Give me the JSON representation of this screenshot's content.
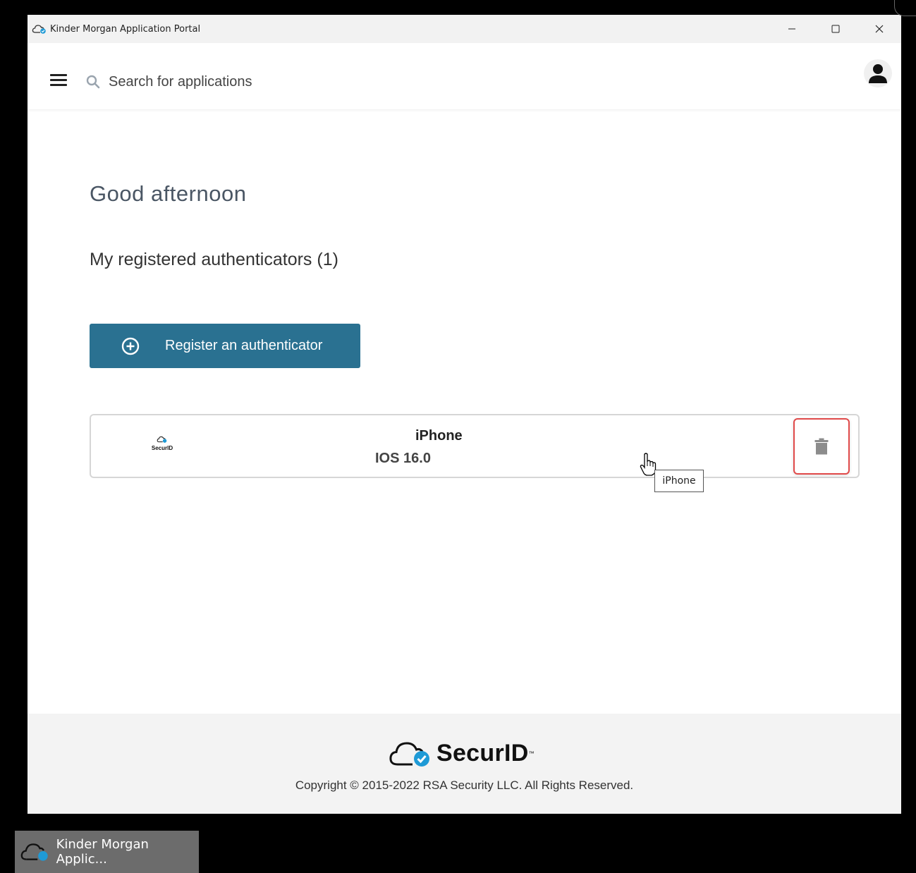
{
  "window": {
    "title": "Kinder Morgan Application Portal",
    "minimize": "–",
    "maximize": "☐",
    "close": "✕"
  },
  "topbar": {
    "search_placeholder": "Search for applications"
  },
  "main": {
    "greeting": "Good afternoon",
    "authenticators_heading": "My registered authenticators (1)",
    "register_button": "Register an authenticator",
    "authenticators": [
      {
        "name": "iPhone",
        "os": "IOS 16.0",
        "logo_text": "SecurID"
      }
    ],
    "tooltip": "iPhone"
  },
  "footer": {
    "brand": "SecurID",
    "copyright": "Copyright © 2015-2022 RSA Security LLC. All Rights Reserved."
  },
  "taskbar": {
    "item_label": "Kinder Morgan Applic..."
  },
  "colors": {
    "primary_button": "#2a7191",
    "highlight_border": "#e04a4a",
    "check_accent": "#1e9ad6"
  }
}
